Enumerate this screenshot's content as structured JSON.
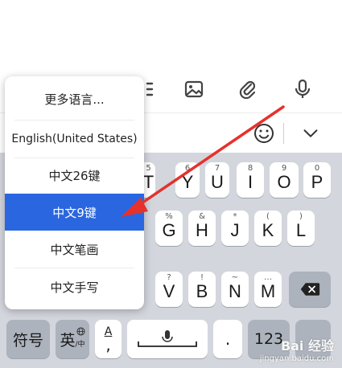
{
  "toolbar": {
    "icons": [
      "list-icon",
      "image-icon",
      "paperclip-icon",
      "microphone-icon"
    ]
  },
  "candidate_bar": {
    "icons": [
      "emoji-icon",
      "collapse-chevron-icon"
    ]
  },
  "language_menu": {
    "items": [
      {
        "label": "更多语言...",
        "selected": false
      },
      {
        "label": "English(United States)",
        "selected": false
      },
      {
        "label": "中文26键",
        "selected": false
      },
      {
        "label": "中文9键",
        "selected": true
      },
      {
        "label": "中文笔画",
        "selected": false
      },
      {
        "label": "中文手写",
        "selected": false
      }
    ],
    "selected_color": "#2a66e0"
  },
  "keyboard": {
    "row1": [
      {
        "hint": "5",
        "label": "T"
      },
      {
        "hint": "6",
        "label": "Y"
      },
      {
        "hint": "7",
        "label": "U"
      },
      {
        "hint": "8",
        "label": "I"
      },
      {
        "hint": "9",
        "label": "O"
      },
      {
        "hint": "0",
        "label": "P"
      }
    ],
    "row2": [
      {
        "hint": "%",
        "label": "G"
      },
      {
        "hint": "&",
        "label": "H"
      },
      {
        "hint": "*",
        "label": "J"
      },
      {
        "hint": "(",
        "label": "K"
      },
      {
        "hint": ")",
        "label": "L"
      }
    ],
    "row3": [
      {
        "hint": "?",
        "label": "V"
      },
      {
        "hint": "!",
        "label": "B"
      },
      {
        "hint": "~",
        "label": "N"
      },
      {
        "hint": "…",
        "label": "M"
      }
    ],
    "backspace_icon": "backspace-icon",
    "bottom": {
      "symbols_label": "符号",
      "lang_label": "英",
      "lang_sub": "/中",
      "globe_icon": "globe-icon",
      "a_label": "A",
      "comma_label": ",",
      "space_mic_icon": "microphone-icon",
      "period_label": ".",
      "numbers_label": "123"
    }
  },
  "annotation": {
    "arrow_color": "#e5322d"
  },
  "watermark": {
    "brand": "Bai 经验",
    "url": "jingyan.baidu.com"
  }
}
